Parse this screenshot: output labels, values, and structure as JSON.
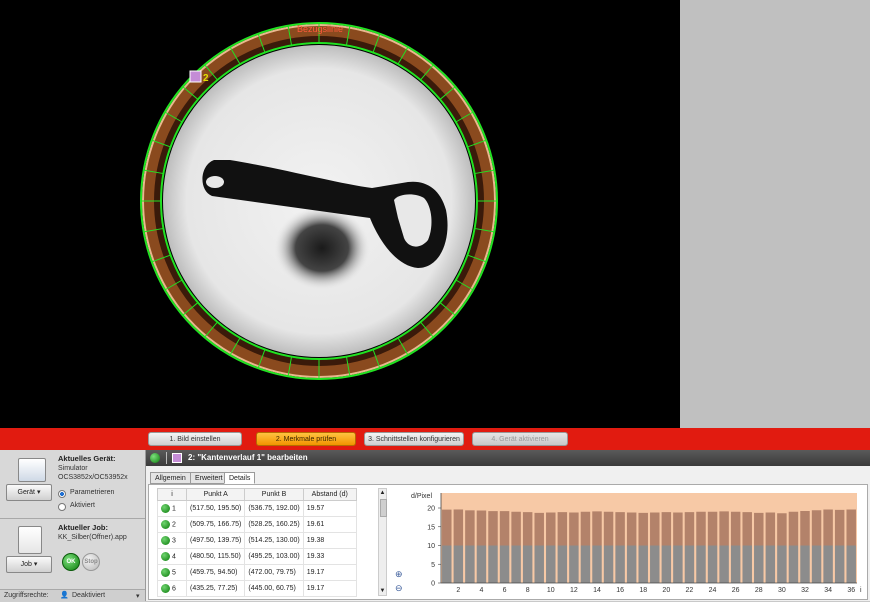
{
  "viewer": {
    "reference_label": "Bezugslinie",
    "feature_number": "2"
  },
  "wizard": {
    "steps": [
      {
        "label": "1. Bild einstellen",
        "state": "normal"
      },
      {
        "label": "2. Merkmale prüfen",
        "state": "active"
      },
      {
        "label": "3. Schnittstellen konfigurieren",
        "state": "normal"
      },
      {
        "label": "4. Gerät aktivieren",
        "state": "disabled"
      }
    ]
  },
  "device": {
    "title": "Aktuelles Gerät:",
    "line1": "Simulator",
    "line2": "OCS3852x/OC53952x",
    "button": "Gerät",
    "mode_param": "Parametrieren",
    "mode_active": "Aktiviert"
  },
  "job": {
    "title": "Aktueller Job:",
    "file": "KK_Silber(Offner).app",
    "button": "Job",
    "ok_label": "OK",
    "second_label": "Stop"
  },
  "status": {
    "access_label": "Zugriffsrechte:",
    "access_value": "Deaktiviert"
  },
  "editor": {
    "title": "2: \"Kantenverlauf 1\" bearbeiten",
    "tabs": [
      "Allgemein",
      "Erweitert",
      "Details"
    ],
    "active_tab": "Details",
    "table": {
      "headers": [
        "i",
        "Punkt A",
        "Punkt B",
        "Abstand (d)"
      ],
      "rows": [
        [
          "1",
          "(517.50, 195.50)",
          "(536.75, 192.00)",
          "19.57"
        ],
        [
          "2",
          "(509.75, 166.75)",
          "(528.25, 160.25)",
          "19.61"
        ],
        [
          "3",
          "(497.50, 139.75)",
          "(514.25, 130.00)",
          "19.38"
        ],
        [
          "4",
          "(480.50, 115.50)",
          "(495.25, 103.00)",
          "19.33"
        ],
        [
          "5",
          "(459.75, 94.50)",
          "(472.00, 79.75)",
          "19.17"
        ],
        [
          "6",
          "(435.25, 77.25)",
          "(445.00, 60.75)",
          "19.17"
        ]
      ]
    }
  },
  "chart_data": {
    "type": "bar",
    "ylabel": "d/Pixel",
    "ylim": [
      0,
      24
    ],
    "yticks": [
      0,
      5,
      10,
      15,
      20
    ],
    "xtick_labels": [
      "2",
      "4",
      "6",
      "8",
      "10",
      "12",
      "14",
      "16",
      "18",
      "20",
      "22",
      "24",
      "26",
      "28",
      "30",
      "32",
      "34",
      "36"
    ],
    "x_axis_letter": "i",
    "categories": [
      "1",
      "2",
      "3",
      "4",
      "5",
      "6",
      "7",
      "8",
      "9",
      "10",
      "11",
      "12",
      "13",
      "14",
      "15",
      "16",
      "17",
      "18",
      "19",
      "20",
      "21",
      "22",
      "23",
      "24",
      "25",
      "26",
      "27",
      "28",
      "29",
      "30",
      "31",
      "32",
      "33",
      "34",
      "35",
      "36"
    ],
    "values": [
      19.57,
      19.61,
      19.38,
      19.33,
      19.17,
      19.17,
      19.0,
      18.9,
      18.7,
      18.8,
      18.9,
      18.8,
      19.0,
      19.1,
      19.0,
      18.9,
      18.8,
      18.7,
      18.8,
      18.9,
      18.8,
      18.9,
      19.0,
      19.0,
      19.1,
      19.0,
      18.9,
      18.7,
      18.8,
      18.6,
      19.0,
      19.2,
      19.4,
      19.6,
      19.5,
      19.6
    ],
    "lower_band": 10,
    "colors": {
      "bar_upper": "#b3826a",
      "bar_lower": "#8c8c8c",
      "background": "#f7c9a6"
    }
  }
}
